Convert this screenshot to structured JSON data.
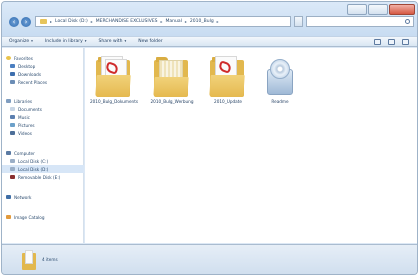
{
  "address": {
    "crumbs": [
      "Local Disk (D:)",
      "MERCHANDISE EXCLUSIVES",
      "Manual",
      "2010_Bulg"
    ]
  },
  "toolbar": {
    "organize": "Organize",
    "include": "Include in library",
    "share": "Share with",
    "new_folder": "New folder"
  },
  "nav": {
    "favorites": "Favorites",
    "desktop": "Desktop",
    "downloads": "Downloads",
    "recent": "Recent Places",
    "libraries": "Libraries",
    "documents": "Documents",
    "music": "Music",
    "pictures": "Pictures",
    "videos": "Videos",
    "computer": "Computer",
    "local_c": "Local Disk (C:)",
    "local_d": "Local Disk (D:)",
    "removable": "Removable Disk (E:)",
    "network": "Network",
    "image_catalog": "Image Catalog"
  },
  "files": [
    {
      "name": "2010_Bulg_Dokum­­ents",
      "kind": "pdf-folder"
    },
    {
      "name": "2010_Bulg_Werbung",
      "kind": "binder-folder"
    },
    {
      "name": "2010_Update",
      "kind": "pdf-folder-2"
    },
    {
      "name": "Readme",
      "kind": "setup"
    }
  ],
  "status": {
    "items": "4 items"
  }
}
